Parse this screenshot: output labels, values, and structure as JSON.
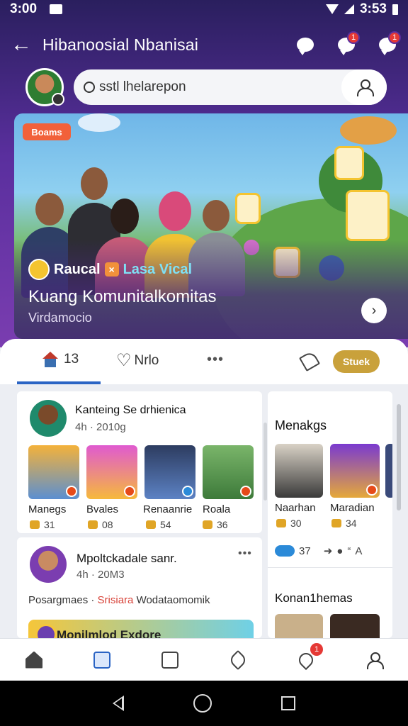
{
  "status_bar": {
    "time": "3:00",
    "clock_right": "3:53"
  },
  "appbar": {
    "title": "Hibanoosial Nbanisai",
    "badges": [
      "1",
      "1"
    ]
  },
  "search": {
    "placeholder": "sstl lhelarepon"
  },
  "hero": {
    "tag": "Boams",
    "brand_left": "Raucal",
    "brand_right": "Lasa Vical",
    "title": "Kuang Komunitalkomitas",
    "subtitle": "Virdamocio"
  },
  "actions": {
    "home_count": "13",
    "like_label": "Nrlo",
    "share_pill": "Stuek"
  },
  "post1": {
    "author": "Kanteing Se drhienica",
    "meta": "4h · 2010g",
    "items": [
      {
        "label": "Manegs",
        "stat": "31"
      },
      {
        "label": "Bvales",
        "stat": "08"
      },
      {
        "label": "Renaanrie",
        "stat": "54"
      },
      {
        "label": "Roala",
        "stat": "36"
      }
    ]
  },
  "post2": {
    "author": "Mpoltckadale sanr.",
    "meta": "4h · 20M3",
    "tag_prefix": "Posargmaes ·",
    "tag_highlight": "Srisiara",
    "tag_suffix": "Wodataomomik",
    "promo": "Monilmlod Exdore"
  },
  "side": {
    "heading": "Menakgs",
    "items": [
      {
        "label": "Naarhan",
        "stat": "30"
      },
      {
        "label": "Maradian",
        "stat": "34"
      }
    ],
    "count": "37",
    "section": "Konan1hemas"
  },
  "bottomnav": {
    "badge": "1"
  },
  "colors": {
    "accent": "#2b64c4",
    "header": "#5a2f9e",
    "badge": "#e53935",
    "pill": "#c9a13b"
  }
}
